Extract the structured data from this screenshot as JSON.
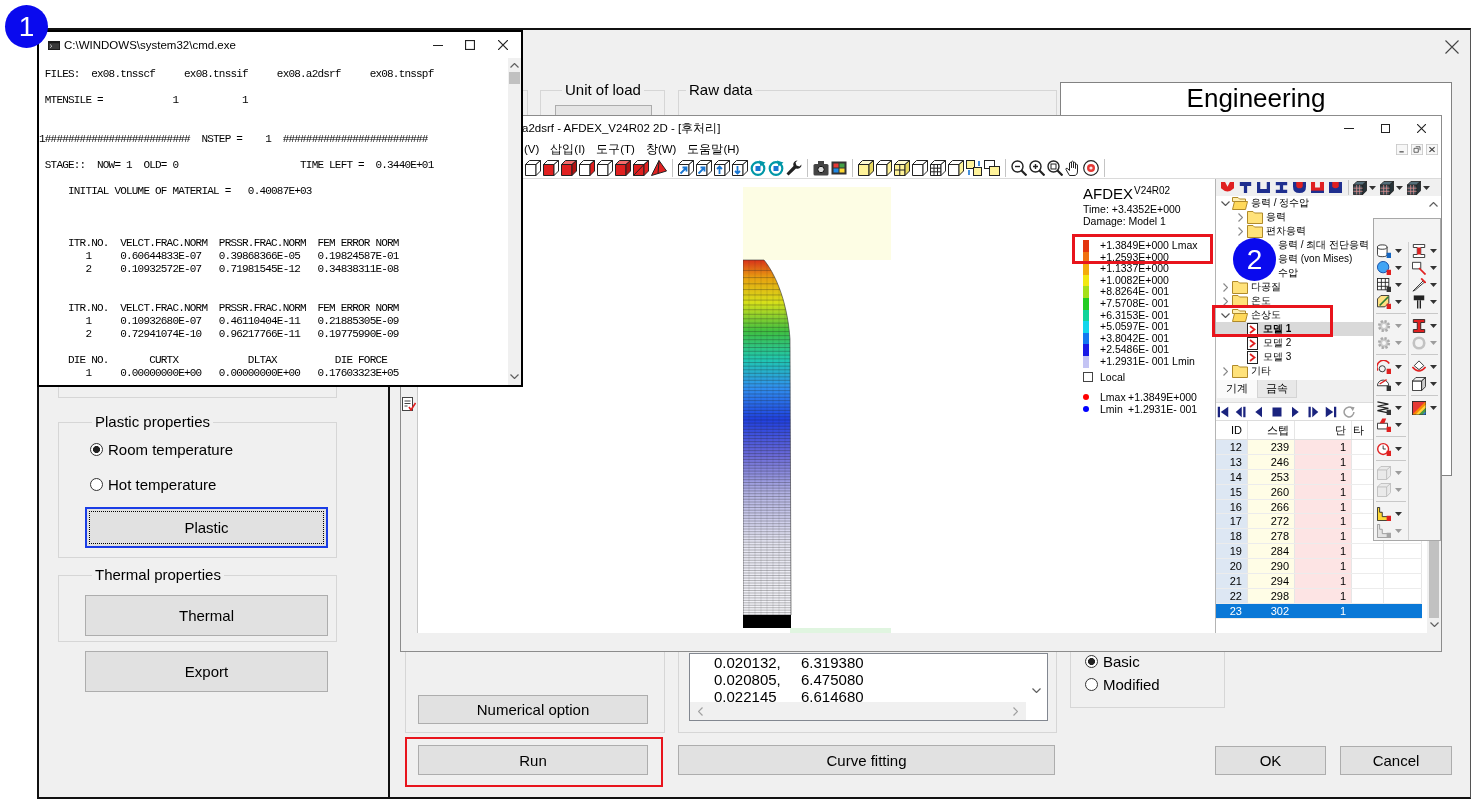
{
  "console": {
    "title": "C:\\WINDOWS\\system32\\cmd.exe",
    "lines": [
      "FILES:  ex08.tnsscf     ex08.tnssif     ex08.a2dsrf     ex08.tnsspf",
      "MTENSILE =            1           1",
      "1#########################  NSTEP =    1  #########################",
      "STAGE::  NOW= 1  OLD= 0                     TIME LEFT =  0.3440E+01",
      "INITIAL VOLUME OF MATERIAL =   0.40087E+03",
      "ITR.NO.  VELCT.FRAC.NORM  PRSSR.FRAC.NORM  FEM ERROR NORM",
      "1     0.60644833E-07   0.39868366E-05   0.19824587E-01",
      "2     0.10932572E-07   0.71981545E-12   0.34838311E-08",
      "ITR.NO.  VELCT.FRAC.NORM  PRSSR.FRAC.NORM  FEM ERROR NORM",
      "1     0.10932680E-07   0.46110404E-11   0.21885305E-09",
      "2     0.72941074E-10   0.96217766E-11   0.19775990E-09",
      "DIE NO.       CURTX            DLTAX          DIE FORCE",
      "1     0.00000000E+00   0.00000000E+00   0.17603323E+05"
    ]
  },
  "afdex": {
    "title": "a2dsrf - AFDEX_V24R02 2D - [후처리]",
    "menu": [
      "(V)",
      "삽입(I)",
      "도구(T)",
      "창(W)",
      "도움말(H)"
    ],
    "legend": {
      "title": "AFDEX$^{V24R02}$",
      "time": "Time: +3.4352E+000",
      "subtitle": "Damage: Model 1",
      "scale": [
        {
          "text": "+1.3849E+000 Lmax",
          "color": "#e3340e",
          "highlighted": true
        },
        {
          "text": "+1.2593E+000",
          "color": "#f07010",
          "highlighted": false
        },
        {
          "text": "+1.1337E+000",
          "color": "#f4ac0c",
          "highlighted": false
        },
        {
          "text": "+1.0082E+000",
          "color": "#f2e812",
          "highlighted": false
        },
        {
          "text": "+8.8264E- 001",
          "color": "#a6e01a",
          "highlighted": false
        },
        {
          "text": "+7.5708E- 001",
          "color": "#22cc22",
          "highlighted": false
        },
        {
          "text": "+6.3153E- 001",
          "color": "#10d49a",
          "highlighted": false
        },
        {
          "text": "+5.0597E- 001",
          "color": "#12d6ec",
          "highlighted": false
        },
        {
          "text": "+3.8042E- 001",
          "color": "#1478f0",
          "highlighted": false
        },
        {
          "text": "+2.5486E- 001",
          "color": "#1a1ae6",
          "highlighted": false
        },
        {
          "text": "+1.2931E- 001 Lmin",
          "color": "#c4c4f4",
          "highlighted": false
        }
      ],
      "local": {
        "label": "Local",
        "checked": false
      },
      "extremes": [
        {
          "label": "Lmax",
          "value": "+1.3849E+000",
          "color": "#ff0000"
        },
        {
          "label": "Lmin",
          "value": "+1.2931E- 001",
          "color": "#0000ff"
        }
      ]
    },
    "tree": [
      {
        "label": "응력 / 정수압",
        "kind": "folder",
        "expanded": true,
        "selected": false,
        "highlighted": false,
        "children": [
          {
            "label": "응력",
            "kind": "folder",
            "expanded": false,
            "selected": false
          },
          {
            "label": "편차응력",
            "kind": "folder",
            "expanded": false,
            "selected": false
          },
          {
            "label": "응력 / 최대 전단응력",
            "kind": "text",
            "selected": false
          },
          {
            "label": "응력 (von Mises)",
            "kind": "text",
            "selected": false
          },
          {
            "label": "수압",
            "kind": "text",
            "selected": false
          }
        ]
      },
      {
        "label": "다공질",
        "kind": "folder",
        "expanded": false,
        "selected": false,
        "highlighted": false
      },
      {
        "label": "온도",
        "kind": "folder",
        "expanded": false,
        "selected": false,
        "highlighted": false
      },
      {
        "label": "손상도",
        "kind": "folder",
        "expanded": true,
        "selected": false,
        "highlighted": true,
        "children": [
          {
            "label": "모델 1",
            "kind": "model",
            "selected": true
          },
          {
            "label": "모델 2",
            "kind": "model",
            "selected": false
          },
          {
            "label": "모델 3",
            "kind": "model",
            "selected": false
          }
        ]
      },
      {
        "label": "기타",
        "kind": "folder",
        "expanded": false,
        "selected": false,
        "highlighted": false
      }
    ],
    "tabs": [
      {
        "label": "기계",
        "selected": true
      },
      {
        "label": "금속",
        "selected": false
      }
    ],
    "table": {
      "columns": [
        "ID",
        "스텝",
        "단",
        "타"
      ],
      "rows": [
        {
          "cells": [
            "12",
            "239",
            "1"
          ],
          "selected": false
        },
        {
          "cells": [
            "13",
            "246",
            "1"
          ],
          "selected": false
        },
        {
          "cells": [
            "14",
            "253",
            "1"
          ],
          "selected": false
        },
        {
          "cells": [
            "15",
            "260",
            "1"
          ],
          "selected": false
        },
        {
          "cells": [
            "16",
            "266",
            "1"
          ],
          "selected": false
        },
        {
          "cells": [
            "17",
            "272",
            "1"
          ],
          "selected": false
        },
        {
          "cells": [
            "18",
            "278",
            "1"
          ],
          "selected": false
        },
        {
          "cells": [
            "19",
            "284",
            "1"
          ],
          "selected": false
        },
        {
          "cells": [
            "20",
            "290",
            "1"
          ],
          "selected": false
        },
        {
          "cells": [
            "21",
            "294",
            "1"
          ],
          "selected": false
        },
        {
          "cells": [
            "22",
            "298",
            "1"
          ],
          "selected": false
        },
        {
          "cells": [
            "23",
            "302",
            "1"
          ],
          "selected": true
        }
      ]
    },
    "floating_toolbar": {
      "left": [
        {
          "disabled": false
        },
        {
          "disabled": false
        },
        {
          "disabled": false
        },
        {
          "disabled": false
        },
        {
          "disabled": true
        },
        {
          "disabled": true
        },
        {
          "disabled": false
        },
        {
          "disabled": false
        },
        {
          "disabled": false
        },
        {
          "disabled": false
        },
        {
          "disabled": false
        },
        {
          "disabled": true
        },
        {
          "disabled": true
        },
        {
          "disabled": false
        },
        {
          "disabled": true
        }
      ],
      "right": [
        {
          "disabled": false
        },
        {
          "disabled": false
        },
        {
          "disabled": false
        },
        {
          "disabled": false
        },
        {
          "disabled": false
        },
        {
          "disabled": true
        },
        {
          "disabled": false
        },
        {
          "disabled": false
        },
        {
          "disabled": false
        }
      ]
    }
  },
  "dialog": {
    "plastic_properties": {
      "title": "Plastic properties",
      "options": [
        {
          "label": "Room temperature",
          "selected": true
        },
        {
          "label": "Hot temperature",
          "selected": false
        }
      ],
      "button": {
        "label": "Plastic",
        "focused": true
      }
    },
    "thermal_properties": {
      "title": "Thermal properties",
      "button": "Thermal"
    },
    "export_button": "Export",
    "unit_of_load": {
      "title": "Unit of load"
    },
    "raw_data": {
      "title": "Raw data",
      "rows": [
        [
          "0.020132,",
          "6.319380"
        ],
        [
          "0.020805,",
          "6.475080"
        ],
        [
          "0.022145",
          "6.614680"
        ]
      ]
    },
    "preview": {
      "title": "Engineering"
    },
    "curve_model": {
      "options": [
        {
          "label": "Basic",
          "selected": true
        },
        {
          "label": "Modified",
          "selected": false
        }
      ]
    },
    "numerical_option_button": "Numerical option",
    "run_button": {
      "label": "Run",
      "highlighted": true
    },
    "curve_fitting_button": "Curve fitting",
    "footer_buttons": [
      "OK",
      "Cancel"
    ]
  },
  "callouts": [
    {
      "label": "1"
    },
    {
      "label": "2"
    }
  ]
}
